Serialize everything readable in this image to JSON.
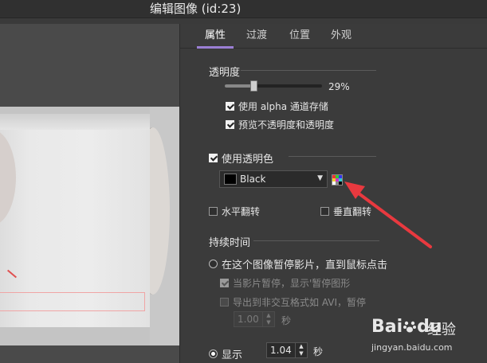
{
  "window": {
    "title": "编辑图像 (id:23)"
  },
  "tabs": [
    {
      "label": "属性",
      "active": true
    },
    {
      "label": "过渡",
      "active": false
    },
    {
      "label": "位置",
      "active": false
    },
    {
      "label": "外观",
      "active": false
    }
  ],
  "opacity": {
    "section_label": "透明度",
    "slider_value": 0.29,
    "value_text": "29%",
    "use_alpha_label": "使用 alpha 通道存储",
    "use_alpha_checked": true,
    "preview_label": "预览不透明度和透明度",
    "preview_checked": true
  },
  "transparent_color": {
    "label": "使用透明色",
    "checked": true,
    "color_name": "Black",
    "color_hex": "#000000"
  },
  "flip": {
    "horizontal_label": "水平翻转",
    "horizontal_checked": false,
    "vertical_label": "垂直翻转",
    "vertical_checked": false
  },
  "duration": {
    "section_label": "持续时间",
    "pause_until_click_label": "在这个图像暂停影片，直到鼠标点击",
    "pause_until_click_selected": false,
    "show_pause_icon_label": "当影片暂停，显示'暂停图形",
    "show_pause_icon_checked": true,
    "export_pause_label": "导出到非交互格式如 AVI，暂停",
    "export_pause_checked": false,
    "export_pause_value": "1.00",
    "export_pause_unit": "秒",
    "display_label": "显示",
    "display_selected": true,
    "display_value": "1.04",
    "display_unit": "秒"
  },
  "watermark": {
    "logo_text": "Bai",
    "logo_suffix": "du",
    "brand": "经验",
    "url": "jingyan.baidu.com"
  },
  "colors": {
    "accent": "#9b7fd4",
    "annotation_red": "#e8393f",
    "panel_bg": "#3b3b3b"
  }
}
